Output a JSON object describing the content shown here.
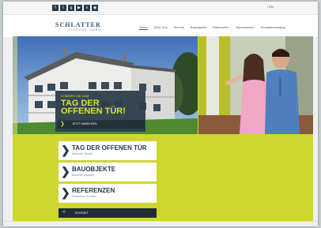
{
  "topbar": {
    "social_icons": [
      "facebook-icon",
      "twitter-icon",
      "google-plus-icon",
      "youtube-icon",
      "xing-icon",
      "rss-icon"
    ],
    "language": "/ EN"
  },
  "brand": {
    "name": "SCHLATTER",
    "tagline": "PLANUNG GMBH"
  },
  "nav": {
    "items": [
      "Home",
      "Über Uns",
      "Service",
      "Bauobjekte",
      "Referenzen",
      "Impressionen",
      "Kompetenzdialog"
    ],
    "active": "Home"
  },
  "hero": {
    "banner_small": "KOMMEN SIE ZUM",
    "banner_title_line1": "TAG DER",
    "banner_title_line2": "OFFENEN TÜR!",
    "banner_link": "JETZT ANMELDEN"
  },
  "cards": [
    {
      "title": "TAG DER OFFENEN TÜR",
      "sub": "Aktuelles Termin"
    },
    {
      "title": "BAUOBJEKTE",
      "sub": "Aktueller Angebot"
    },
    {
      "title": "REFERENZEN",
      "sub": "Zufriedene Kunden"
    }
  ],
  "contact": {
    "label": "KONTAKT"
  },
  "colors": {
    "accent": "#cfd630",
    "navy": "#26384c",
    "dark_bar": "#1e2d38"
  }
}
